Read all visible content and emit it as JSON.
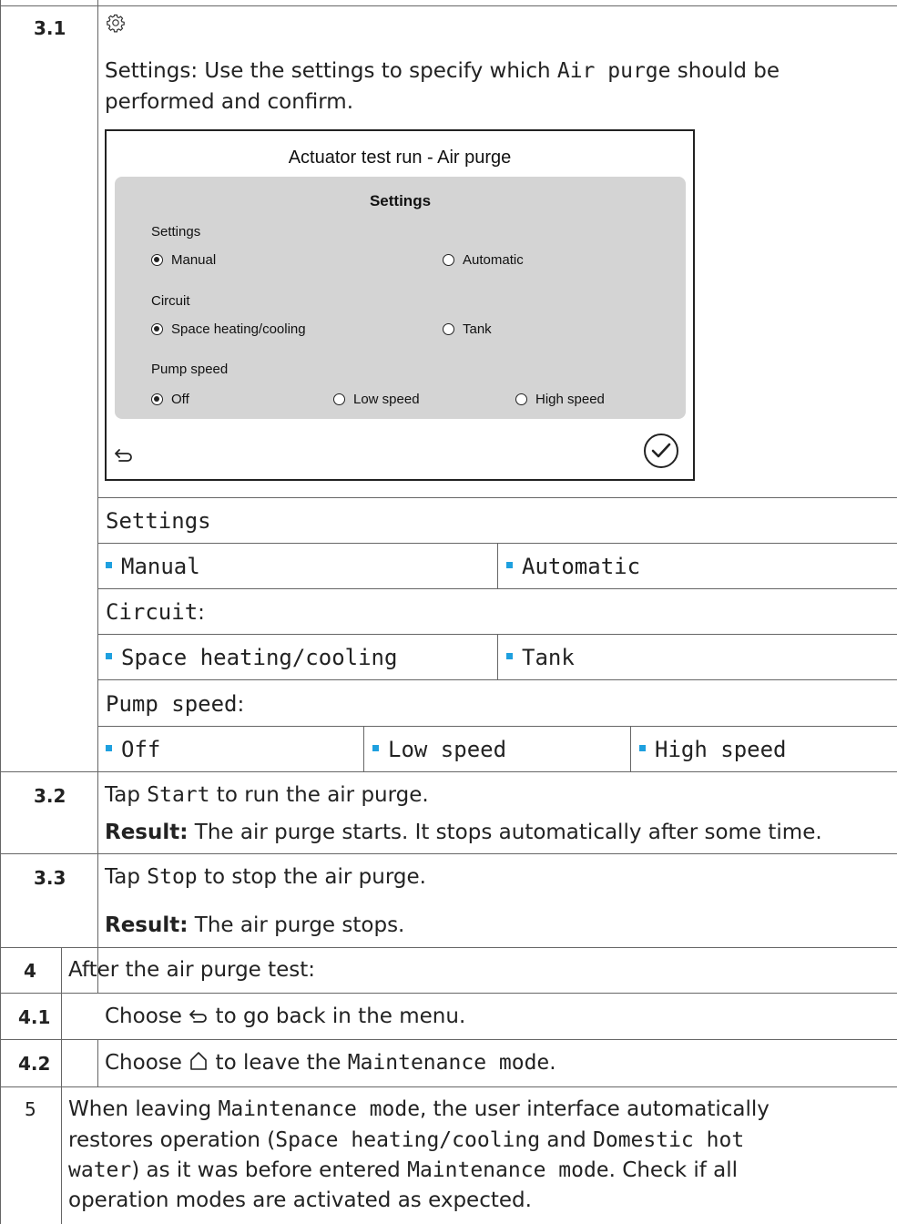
{
  "step_3_1": {
    "number": "3.1",
    "gear_icon": "gear-icon",
    "intro_prefix": "Settings: Use the settings to specify which ",
    "intro_code": "Air purge",
    "intro_suffix": " should be",
    "intro_line2": "performed and confirm.",
    "screen": {
      "title": "Actuator test run  -  Air purge",
      "panel_title": "Settings",
      "settings_label": "Settings",
      "settings_options": [
        {
          "label": "Manual",
          "selected": true
        },
        {
          "label": "Automatic",
          "selected": false
        }
      ],
      "circuit_label": "Circuit",
      "circuit_options": [
        {
          "label": "Space heating/cooling",
          "selected": true
        },
        {
          "label": "Tank",
          "selected": false
        }
      ],
      "pump_label": "Pump speed",
      "pump_options": [
        {
          "label": "Off",
          "selected": true
        },
        {
          "label": "Low speed",
          "selected": false
        },
        {
          "label": "High speed",
          "selected": false
        }
      ],
      "back_icon": "back-arrow-icon",
      "confirm_icon": "check-circle-icon"
    },
    "table": {
      "settings_header": "Settings",
      "settings_values": [
        "Manual",
        "Automatic"
      ],
      "circuit_header": "Circuit",
      "circuit_values": [
        "Space heating/cooling",
        "Tank"
      ],
      "pump_header": "Pump speed",
      "pump_values": [
        "Off",
        "Low speed",
        "High speed"
      ],
      "colon": ":"
    }
  },
  "step_3_2": {
    "number": "3.2",
    "line1_prefix": "Tap ",
    "line1_code": "Start",
    "line1_suffix": " to run the air purge.",
    "result_label": "Result:",
    "result_text": " The air purge starts. It stops automatically after some time."
  },
  "step_3_3": {
    "number": "3.3",
    "line1_prefix": "Tap ",
    "line1_code": "Stop",
    "line1_suffix": " to stop the air purge.",
    "result_label": "Result:",
    "result_text": " The air purge stops."
  },
  "step_4": {
    "number": "4",
    "text": "After the air purge test:"
  },
  "step_4_1": {
    "number": "4.1",
    "prefix": "Choose ",
    "icon": "back-arrow-icon",
    "suffix": " to go back in the menu."
  },
  "step_4_2": {
    "number": "4.2",
    "prefix": "Choose ",
    "icon": "home-icon",
    "suffix_pre": " to leave the ",
    "code": "Maintenance mode",
    "suffix": "."
  },
  "step_5": {
    "number": "5",
    "l1_a": "When leaving ",
    "l1_code": "Maintenance mode",
    "l1_b": ", the user interface automatically",
    "l2_a": "restores operation (",
    "l2_code1": "Space heating/cooling",
    "l2_b": " and ",
    "l2_code2": "Domestic hot",
    "l3_code": "water",
    "l3_b": ") as it was before entered ",
    "l3_code2": "Maintenance mode",
    "l3_c": ". Check if all",
    "l4": "operation modes are activated as expected."
  }
}
